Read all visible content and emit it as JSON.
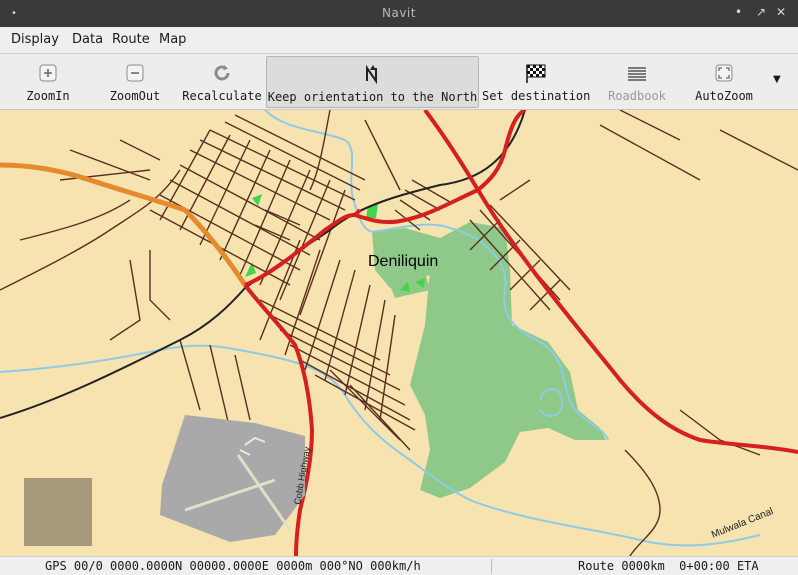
{
  "window": {
    "title": "Navit",
    "controls": [
      "•",
      "↗",
      "✕"
    ]
  },
  "menubar": {
    "items": [
      {
        "label": "Display"
      },
      {
        "label": "Data"
      },
      {
        "label": "Route"
      },
      {
        "label": "Map"
      }
    ]
  },
  "toolbar": {
    "buttons": [
      {
        "label": "ZoomIn",
        "icon": "zoom-in-icon",
        "enabled": true
      },
      {
        "label": "ZoomOut",
        "icon": "zoom-out-icon",
        "enabled": true
      },
      {
        "label": "Recalculate",
        "icon": "refresh-icon",
        "enabled": true
      },
      {
        "label": "Keep orientation to the North",
        "icon": "north-icon",
        "enabled": true,
        "active": true
      },
      {
        "label": "Set destination",
        "icon": "checkered-flag-icon",
        "enabled": true
      },
      {
        "label": "Roadbook",
        "icon": "roadbook-icon",
        "enabled": false
      },
      {
        "label": "AutoZoom",
        "icon": "autozoom-icon",
        "enabled": true
      }
    ],
    "overflow_icon": "overflow-arrow-icon"
  },
  "map": {
    "city_label": "Deniliquin",
    "road_labels": {
      "highway": "Cobb Highway",
      "canal": "Mulwala Canal"
    },
    "colors": {
      "land": "#f7e3b0",
      "park": "#8fc98a",
      "water": "#8ecbe6",
      "main_road": "#d61f1f",
      "primary_road": "#e68a2e",
      "minor_road": "#5a2e1e",
      "railway": "#222222",
      "airport": "#a9a9a9"
    }
  },
  "statusbar": {
    "gps": "GPS 00/0 0000.0000N 00000.0000E 0000m 000°NO 000km/h",
    "route": "Route 0000km  0+00:00 ETA"
  }
}
